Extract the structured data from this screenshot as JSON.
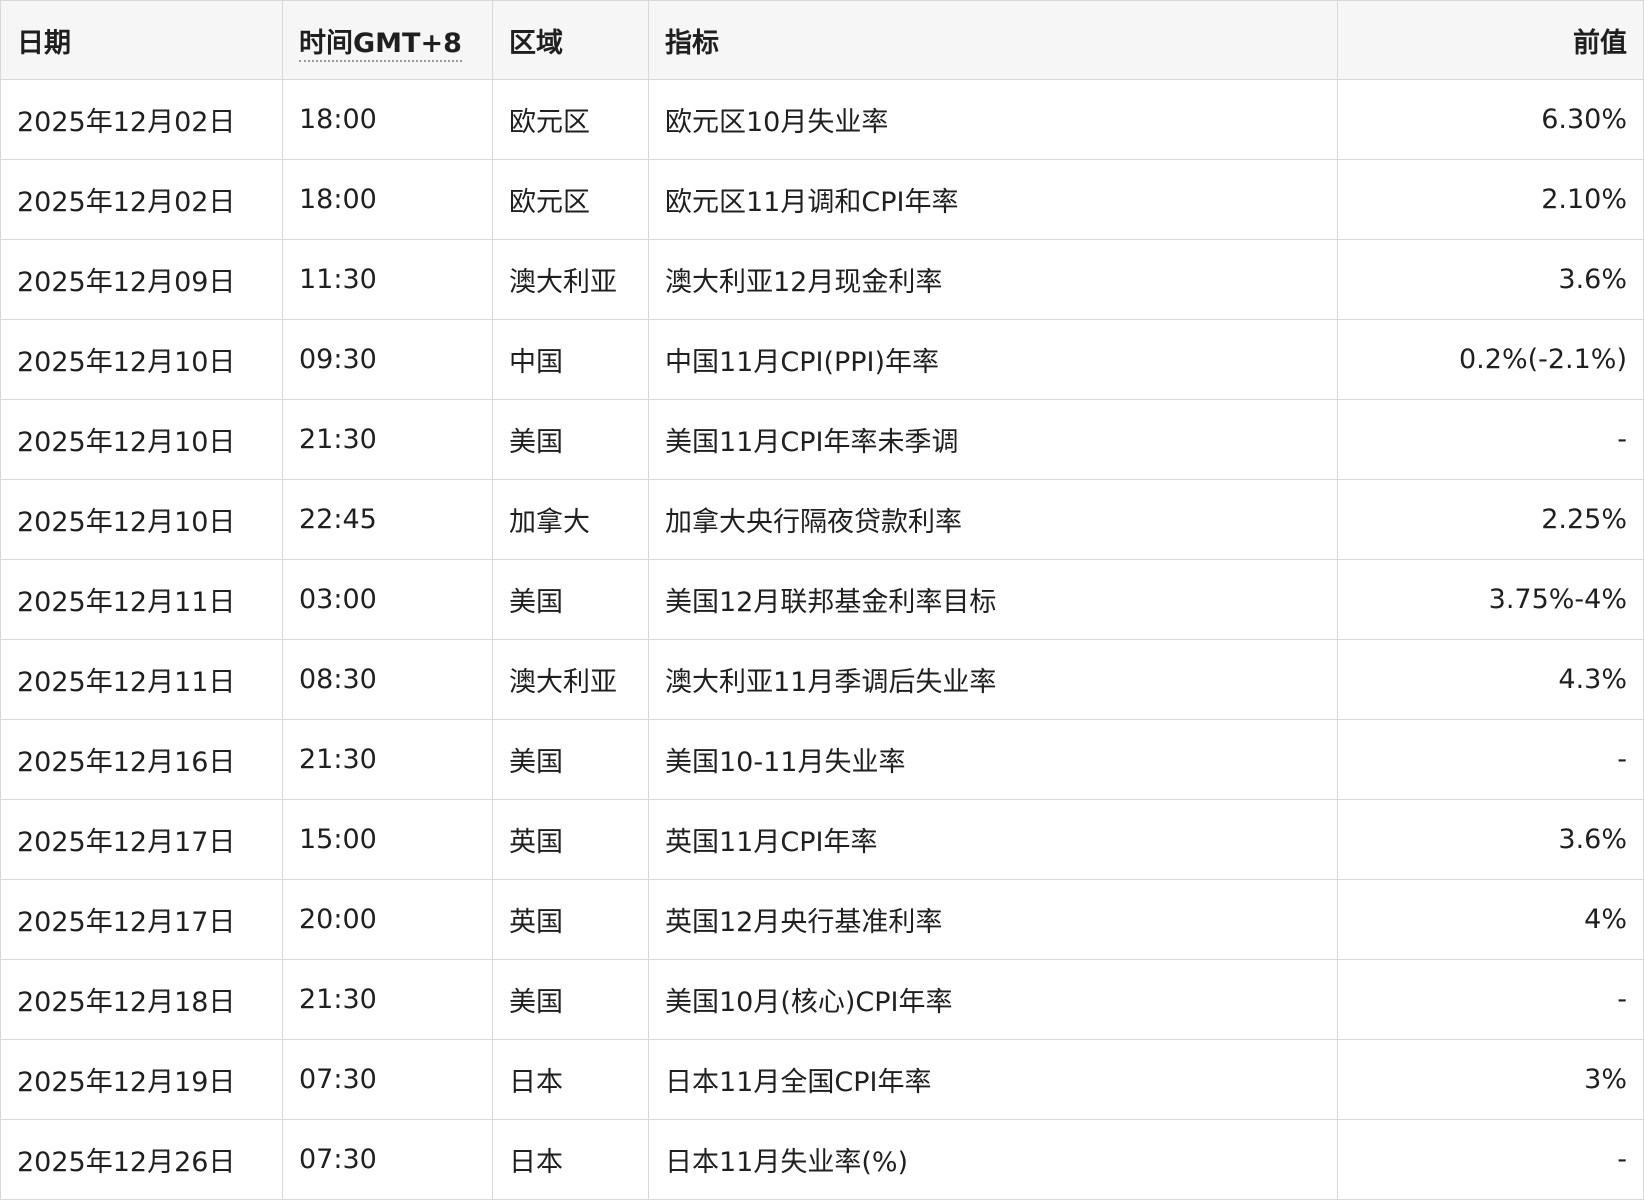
{
  "columns": [
    "日期",
    "时间GMT+8",
    "区域",
    "指标",
    "前值"
  ],
  "rows": [
    {
      "date": "2025年12月02日",
      "time": "18:00",
      "region": "欧元区",
      "indicator": "欧元区10月失业率",
      "prev": "6.30%"
    },
    {
      "date": "2025年12月02日",
      "time": "18:00",
      "region": "欧元区",
      "indicator": "欧元区11月调和CPI年率",
      "prev": "2.10%"
    },
    {
      "date": "2025年12月09日",
      "time": "11:30",
      "region": "澳大利亚",
      "indicator": "澳大利亚12月现金利率",
      "prev": "3.6%"
    },
    {
      "date": "2025年12月10日",
      "time": "09:30",
      "region": "中国",
      "indicator": "中国11月CPI(PPI)年率",
      "prev": "0.2%(-2.1%)"
    },
    {
      "date": "2025年12月10日",
      "time": "21:30",
      "region": "美国",
      "indicator": "美国11月CPI年率未季调",
      "prev": "-"
    },
    {
      "date": "2025年12月10日",
      "time": "22:45",
      "region": "加拿大",
      "indicator": "加拿大央行隔夜贷款利率",
      "prev": "2.25%"
    },
    {
      "date": "2025年12月11日",
      "time": "03:00",
      "region": "美国",
      "indicator": "美国12月联邦基金利率目标",
      "prev": "3.75%-4%"
    },
    {
      "date": "2025年12月11日",
      "time": "08:30",
      "region": "澳大利亚",
      "indicator": "澳大利亚11月季调后失业率",
      "prev": "4.3%"
    },
    {
      "date": "2025年12月16日",
      "time": "21:30",
      "region": "美国",
      "indicator": "美国10-11月失业率",
      "prev": "-"
    },
    {
      "date": "2025年12月17日",
      "time": "15:00",
      "region": "英国",
      "indicator": "英国11月CPI年率",
      "prev": "3.6%"
    },
    {
      "date": "2025年12月17日",
      "time": "20:00",
      "region": "英国",
      "indicator": "英国12月央行基准利率",
      "prev": "4%"
    },
    {
      "date": "2025年12月18日",
      "time": "21:30",
      "region": "美国",
      "indicator": "美国10月(核心)CPI年率",
      "prev": "-"
    },
    {
      "date": "2025年12月19日",
      "time": "07:30",
      "region": "日本",
      "indicator": "日本11月全国CPI年率",
      "prev": "3%"
    },
    {
      "date": "2025年12月26日",
      "time": "07:30",
      "region": "日本",
      "indicator": "日本11月失业率(%)",
      "prev": "-"
    }
  ]
}
